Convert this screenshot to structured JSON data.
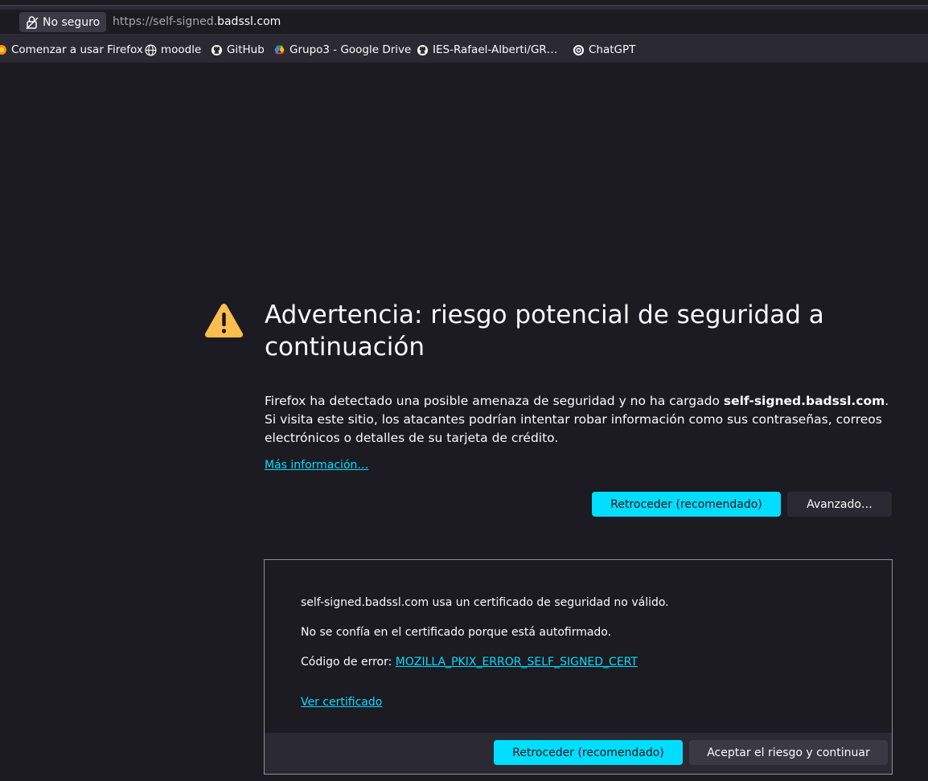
{
  "browser": {
    "identity_label": "No seguro",
    "url_prefix": "https://self-signed.",
    "url_domain": "badssl.com",
    "bookmarks": [
      {
        "label": "Comenzar a usar Firefox",
        "icon": "firefox-icon"
      },
      {
        "label": "moodle",
        "icon": "globe-icon"
      },
      {
        "label": "GitHub",
        "icon": "github-icon"
      },
      {
        "label": "Grupo3 - Google Drive",
        "icon": "google-drive-icon"
      },
      {
        "label": "IES-Rafael-Alberti/GR…",
        "icon": "github-icon"
      },
      {
        "label": "ChatGPT",
        "icon": "chatgpt-icon"
      }
    ]
  },
  "warning": {
    "title": "Advertencia: riesgo potencial de seguridad a continuación",
    "intro_before": "Firefox ha detectado una posible amenaza de seguridad y no ha cargado ",
    "intro_host": "self-signed.badssl.com",
    "intro_after": ". Si visita este sitio, los atacantes podrían intentar robar información como sus contraseñas, correos electrónicos o detalles de su tarjeta de crédito.",
    "learn_more": "Más información…",
    "go_back_label": "Retroceder (recomendado)",
    "advanced_label": "Avanzado…"
  },
  "advanced": {
    "line1": "self-signed.badssl.com usa un certificado de seguridad no válido.",
    "line2": "No se confía en el certificado porque está autofirmado.",
    "error_code_prefix": "Código de error: ",
    "error_code": "MOZILLA_PKIX_ERROR_SELF_SIGNED_CERT",
    "view_certificate": "Ver certificado",
    "go_back_label": "Retroceder (recomendado)",
    "accept_label": "Aceptar el riesgo y continuar"
  },
  "colors": {
    "accent": "#00ddff",
    "background": "#1c1b22",
    "warning_icon": "#ffbd4f"
  }
}
